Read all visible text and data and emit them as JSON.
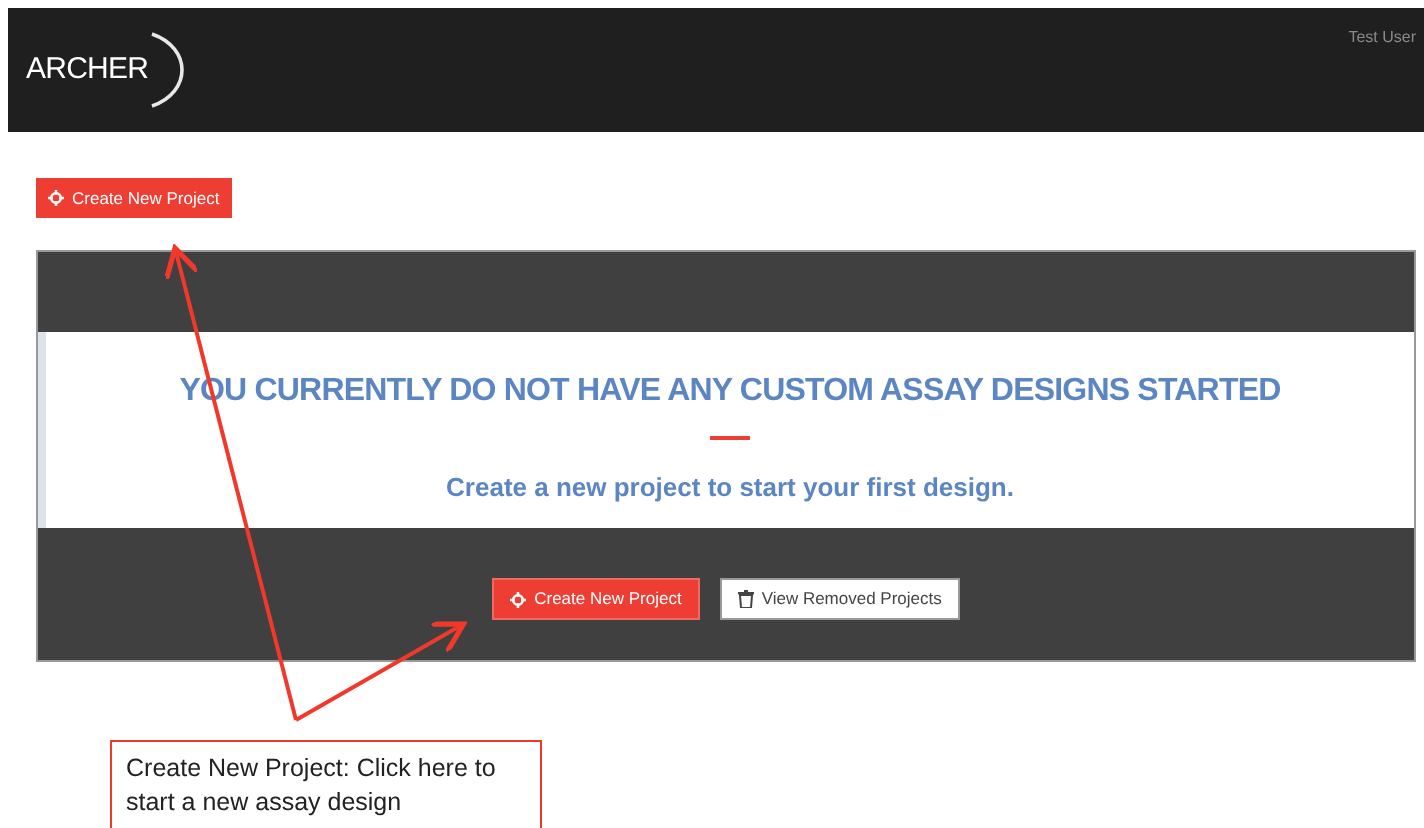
{
  "header": {
    "logo": "ARCHER",
    "user": "Test User"
  },
  "top_button": {
    "label": "Create New Project",
    "kind": "primary"
  },
  "panel": {
    "title": "YOU CURRENTLY DO NOT HAVE ANY CUSTOM ASSAY DESIGNS STARTED",
    "subtitle": "Create a new project to start your first design.",
    "buttons": [
      {
        "label": "Create New Project",
        "kind": "primary"
      },
      {
        "label": "View Removed Projects",
        "kind": "secondary"
      }
    ]
  },
  "callout": {
    "text": "Create New Project: Click here to start a new assay design"
  }
}
